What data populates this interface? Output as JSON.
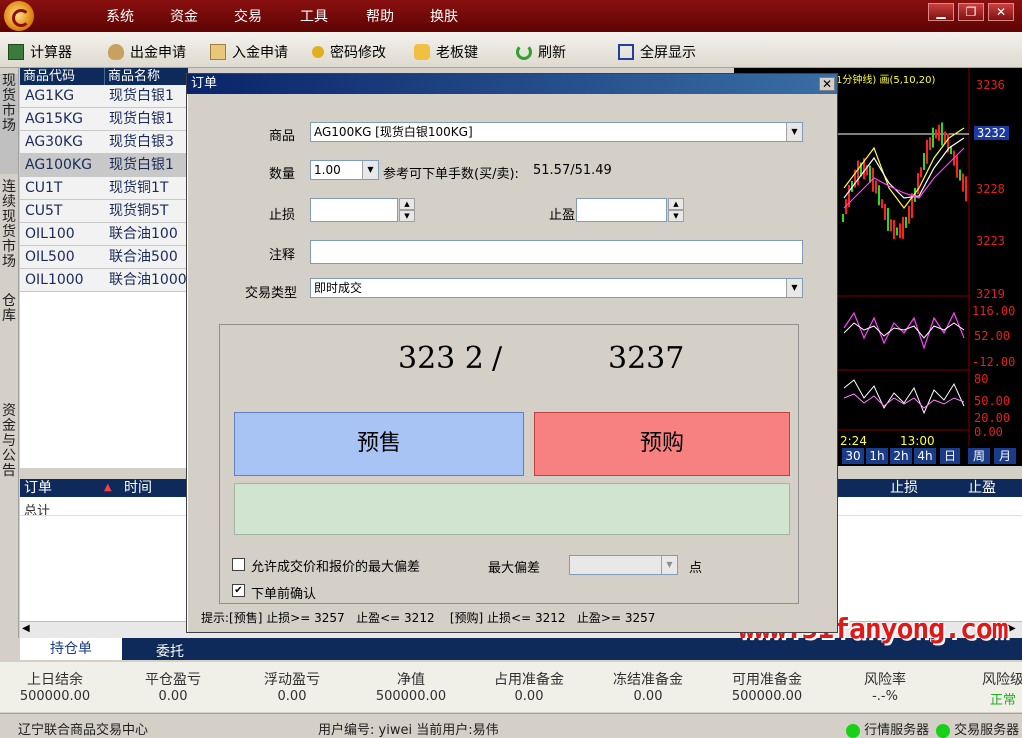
{
  "menubar": {
    "items": [
      "系统",
      "资金",
      "交易",
      "工具",
      "帮助",
      "换肤"
    ],
    "window_buttons": [
      "▁",
      "❐",
      "✕"
    ]
  },
  "toolbar": {
    "items": [
      {
        "label": "计算器",
        "icon": "calculator-icon"
      },
      {
        "label": "出金申请",
        "icon": "money-bag-icon"
      },
      {
        "label": "入金申请",
        "icon": "deposit-icon"
      },
      {
        "label": "密码修改",
        "icon": "key-icon"
      },
      {
        "label": "老板键",
        "icon": "hand-icon"
      },
      {
        "label": "刷新",
        "icon": "refresh-icon"
      },
      {
        "label": "全屏显示",
        "icon": "fullscreen-icon"
      }
    ]
  },
  "left_tabs": [
    "现货市场",
    "连续现货市场",
    "仓库",
    "资金与公告"
  ],
  "product_table": {
    "headers": [
      "商品代码",
      "商品名称"
    ],
    "rows": [
      {
        "code": "AG1KG",
        "name": "现货白银1"
      },
      {
        "code": "AG15KG",
        "name": "现货白银1"
      },
      {
        "code": "AG30KG",
        "name": "现货白银3"
      },
      {
        "code": "AG100KG",
        "name": "现货白银1"
      },
      {
        "code": "CU1T",
        "name": "现货铜1T"
      },
      {
        "code": "CU5T",
        "name": "现货铜5T"
      },
      {
        "code": "OIL100",
        "name": "联合油100"
      },
      {
        "code": "OIL500",
        "name": "联合油500"
      },
      {
        "code": "OIL1000",
        "name": "联合油1000"
      }
    ],
    "selected_index": 3
  },
  "chart": {
    "header": "1分钟线) 画(5,10,20)",
    "price_labels": [
      "3236",
      "3232",
      "3228",
      "3223",
      "3219"
    ],
    "indicator1_labels": [
      "116.00",
      "52.00",
      "-12.00"
    ],
    "indicator2_labels": [
      "80",
      "50.00",
      "20.00",
      "0.00"
    ],
    "time_labels": [
      "2:24",
      "13:00"
    ],
    "timeframes": [
      "30",
      "1h",
      "2h",
      "4h",
      "日",
      "周",
      "月"
    ]
  },
  "orders": {
    "headers": [
      "订单",
      "时间"
    ],
    "right_headers": [
      "止损",
      "止盈"
    ],
    "total_label": "总计",
    "bottom_tabs": [
      "持仓单",
      "委托"
    ]
  },
  "stats": [
    {
      "label": "上日结余",
      "value": "500000.00"
    },
    {
      "label": "平仓盈亏",
      "value": "0.00"
    },
    {
      "label": "浮动盈亏",
      "value": "0.00"
    },
    {
      "label": "净值",
      "value": "500000.00"
    },
    {
      "label": "占用准备金",
      "value": "0.00"
    },
    {
      "label": "冻结准备金",
      "value": "0.00"
    },
    {
      "label": "可用准备金",
      "value": "500000.00"
    },
    {
      "label": "风险率",
      "value": "-.-%"
    },
    {
      "label": "风险级",
      "value": "正常"
    }
  ],
  "statusbar": {
    "exchange": "辽宁联合商品交易中心",
    "user_info": "用户编号: yiwei 当前用户:易伟",
    "quote_server": "行情服务器",
    "trade_server": "交易服务器"
  },
  "dialog": {
    "title": "订单",
    "close_label": "✕",
    "product_label": "商品",
    "product_value": "AG100KG [现货白银100KG]",
    "qty_label": "数量",
    "qty_value": "1.00",
    "ref_label": "参考可下单手数(买/卖):",
    "ref_value": "51.57/51.49",
    "stoploss_label": "止损",
    "takeprofit_label": "止盈",
    "note_label": "注释",
    "trade_type_label": "交易类型",
    "trade_type_value": "即时成交",
    "sell_price": "323 2",
    "price_sep": "/",
    "buy_price": "3237",
    "sell_label": "预售",
    "buy_label": "预购",
    "allow_deviation_label": "允许成交价和报价的最大偏差",
    "max_deviation_label": "最大偏差",
    "points_label": "点",
    "confirm_label": "下单前确认",
    "allow_deviation_checked": false,
    "confirm_checked": true,
    "hint": "提示:[预售] 止损>= 3257   止盈<= 3212    [预购] 止损<= 3212   止盈>= 3257"
  },
  "watermark": "www.51fanyong.com",
  "colors": {
    "menubar": "#6e0808",
    "header_navy": "#0e2a5a",
    "sell": "#a8c4f4",
    "buy": "#f78080",
    "status_green": "#18d018"
  }
}
